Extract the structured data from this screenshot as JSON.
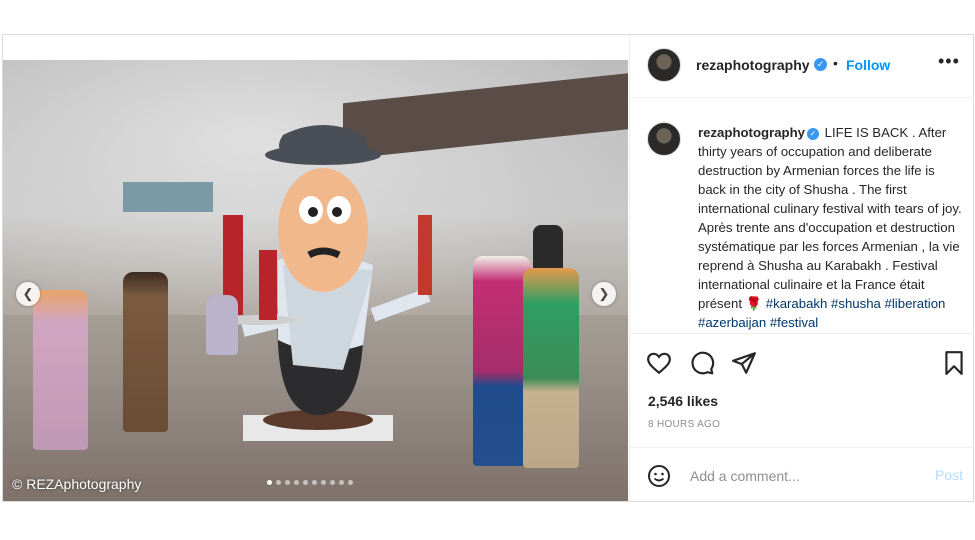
{
  "post": {
    "media": {
      "copyright": "© REZAphotography",
      "carousel": {
        "total_slides": 10,
        "active_index": 0
      }
    },
    "header": {
      "username": "rezaphotography",
      "separator": "•",
      "follow_label": "Follow",
      "more_label": "•••"
    },
    "caption": {
      "username": "rezaphotography",
      "text": "LIFE IS BACK . After thirty years of occupation and deliberate destruction by Armenian forces the life is back in the city of Shusha . The first international culinary festival with tears of joy. Après trente ans d'occupation et destruction systématique par les forces Armenian , la vie reprend à Shusha au Karabakh . Festival international culinaire et la France était présent",
      "emoji": "🌹",
      "hashtags": "#karabakh #shusha #liberation #azerbaijan #festival"
    },
    "likes": "2,546 likes",
    "time": "8 HOURS AGO",
    "comment": {
      "placeholder": "Add a comment...",
      "post_label": "Post"
    },
    "icons": {
      "prev": "chevron-left-icon",
      "next": "chevron-right-icon",
      "like": "heart-icon",
      "comment": "comment-icon",
      "share": "paper-plane-icon",
      "save": "bookmark-icon",
      "emoji": "smiley-icon",
      "verified": "verified-badge-icon"
    },
    "colors": {
      "accent": "#0095f6",
      "verified": "#3897f0",
      "hashtag": "#00376b",
      "muted": "#8e8e8e"
    }
  }
}
